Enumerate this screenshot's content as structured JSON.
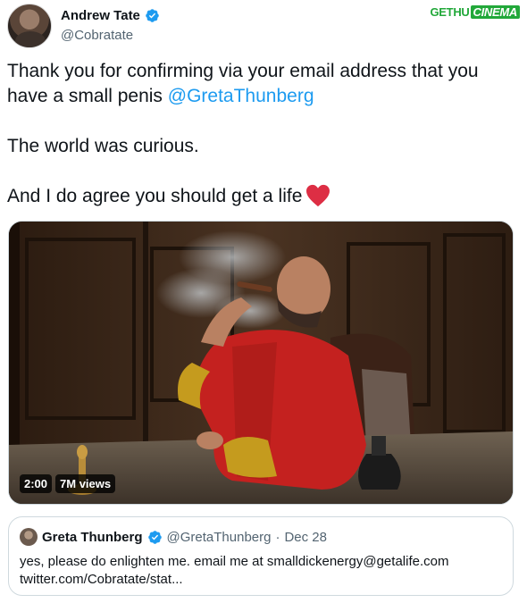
{
  "author": {
    "display_name": "Andrew Tate",
    "handle": "@Cobratate"
  },
  "watermark": {
    "left": "GETHU",
    "right": "CINEMA"
  },
  "tweet": {
    "line1_text": "Thank you for confirming via your email address that you have a small penis ",
    "line1_mention": "@GretaThunberg",
    "line2": "The world was curious.",
    "line3": "And I do agree you should get a life"
  },
  "media": {
    "duration": "2:00",
    "views": "7M views"
  },
  "quoted_tweet": {
    "display_name": "Greta Thunberg",
    "handle": "@GretaThunberg",
    "separator": "·",
    "date": "Dec 28",
    "body_line1": "yes, please do enlighten me. email me at smalldickenergy@getalife.com",
    "body_line2": "twitter.com/Cobratate/stat..."
  },
  "colors": {
    "accent": "#1d9bf0",
    "heart": "#f91880",
    "verified": "#1d9bf0",
    "watermark_green": "#22a83a"
  }
}
